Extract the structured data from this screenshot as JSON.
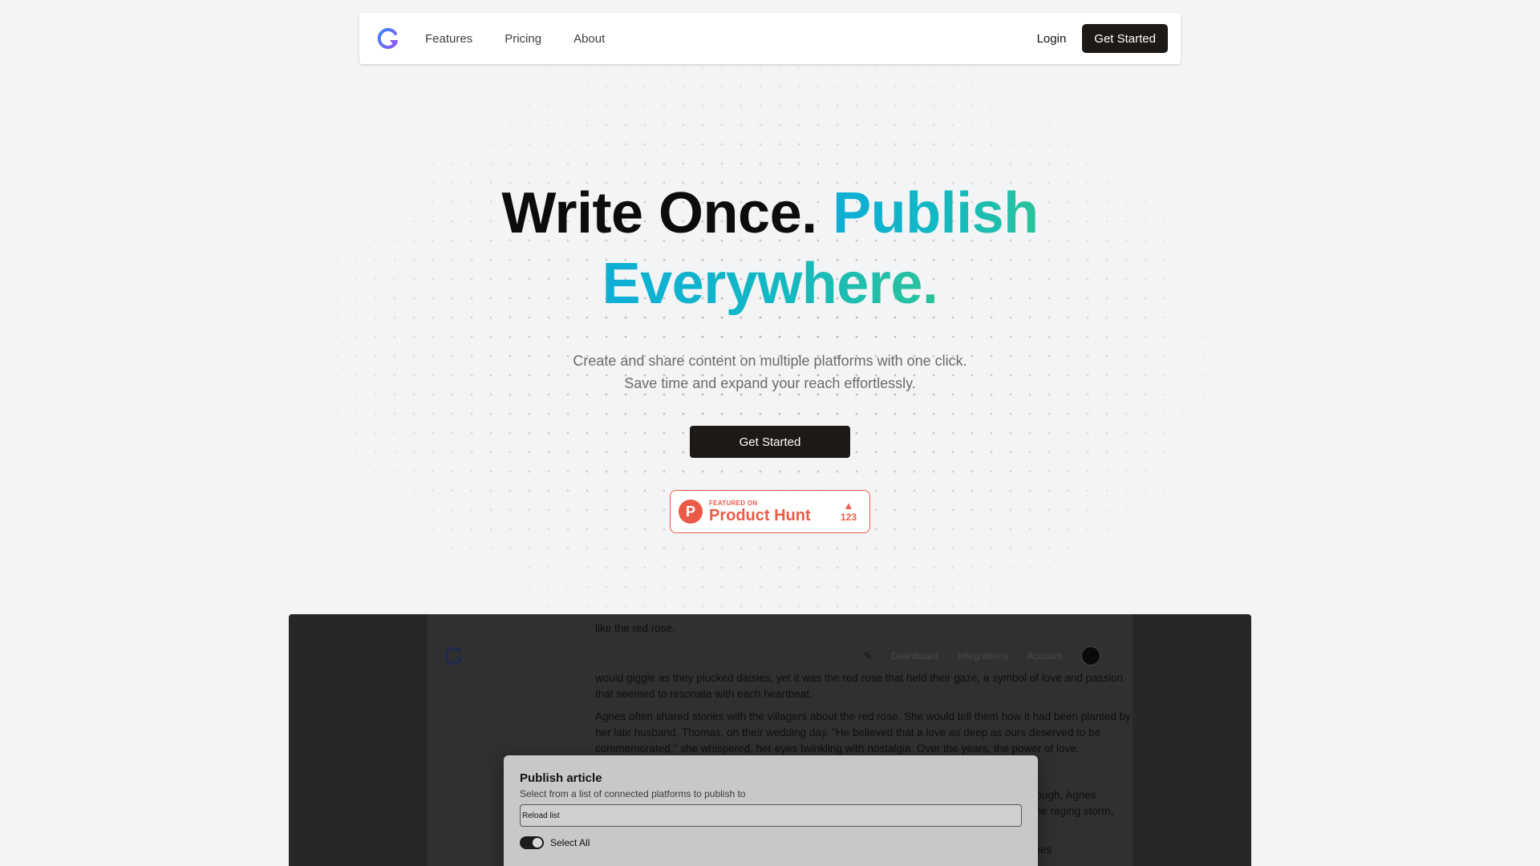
{
  "nav": {
    "links": [
      "Features",
      "Pricing",
      "About"
    ],
    "login": "Login",
    "cta": "Get Started"
  },
  "hero": {
    "title_part1": "Write Once.",
    "title_part2": "Publish",
    "title_part3": "Everywhere.",
    "subtitle": "Create and share content on multiple platforms with one click. Save time and expand your reach effortlessly.",
    "cta": "Get Started"
  },
  "product_hunt": {
    "featured_on": "FEATURED ON",
    "name": "Product Hunt",
    "votes": "123"
  },
  "preview": {
    "nav_links": [
      "Dashboard",
      "Integrations",
      "Account"
    ],
    "article": [
      "like the red rose.",
      "would giggle as they plucked daisies, yet it was the red rose that held their gaze, a symbol of love and passion that seemed to resonate with each heartbeat.",
      "Agnes often shared stories with the villagers about the red rose. She would tell them how it had been planted by her late husband, Thomas, on their wedding day. \"He believed that a love as deep as ours deserved to be commemorated,\" she whispered, her eyes twinkling with nostalgia. Over the years, the power of love.",
      "crept through, Agnes rushed the raging storm, ever.",
      "now, Agnes"
    ],
    "modal": {
      "title": "Publish article",
      "description": "Select from a list of connected platforms to publish to",
      "input_value": "Reload list",
      "toggle_label": "Select All"
    }
  },
  "colors": {
    "accent_start": "#0eaed6",
    "accent_end": "#2ac39a",
    "dark_button": "#1c1917",
    "product_hunt": "#ea5a47"
  }
}
